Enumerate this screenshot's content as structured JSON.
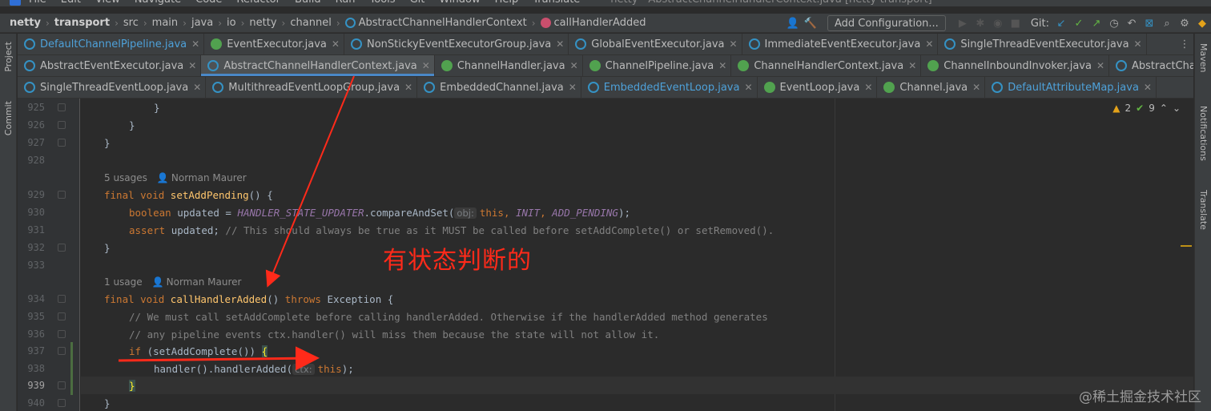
{
  "menubar": {
    "items": [
      "File",
      "Edit",
      "View",
      "Navigate",
      "Code",
      "Refactor",
      "Build",
      "Run",
      "Tools",
      "Git",
      "Window",
      "Help",
      "Translate"
    ],
    "window_title": "netty - AbstractChannelHandlerContext.java [netty-transport]"
  },
  "breadcrumb": {
    "items": [
      "netty",
      "transport",
      "src",
      "main",
      "java",
      "io",
      "netty",
      "channel",
      "AbstractChannelHandlerContext",
      "callHandlerAdded"
    ]
  },
  "toolbar": {
    "add_configuration": "Add Configuration...",
    "git_label": "Git:"
  },
  "tabs": {
    "row1": [
      {
        "label": "DefaultChannelPipeline.java",
        "icon": "class-icon",
        "highlighted": true
      },
      {
        "label": "EventExecutor.java",
        "icon": "interface-icon"
      },
      {
        "label": "NonStickyEventExecutorGroup.java",
        "icon": "class-icon"
      },
      {
        "label": "GlobalEventExecutor.java",
        "icon": "class-icon"
      },
      {
        "label": "ImmediateEventExecutor.java",
        "icon": "class-icon"
      },
      {
        "label": "SingleThreadEventExecutor.java",
        "icon": "class-icon"
      }
    ],
    "row2": [
      {
        "label": "AbstractEventExecutor.java",
        "icon": "class-icon"
      },
      {
        "label": "AbstractChannelHandlerContext.java",
        "icon": "class-icon",
        "active": true
      },
      {
        "label": "ChannelHandler.java",
        "icon": "interface-icon"
      },
      {
        "label": "ChannelPipeline.java",
        "icon": "interface-icon"
      },
      {
        "label": "ChannelHandlerContext.java",
        "icon": "interface-icon"
      },
      {
        "label": "ChannelInboundInvoker.java",
        "icon": "interface-icon"
      },
      {
        "label": "AbstractChannel.java",
        "icon": "class-icon"
      }
    ],
    "row3": [
      {
        "label": "SingleThreadEventLoop.java",
        "icon": "class-icon"
      },
      {
        "label": "MultithreadEventLoopGroup.java",
        "icon": "class-icon"
      },
      {
        "label": "EmbeddedChannel.java",
        "icon": "class-icon"
      },
      {
        "label": "EmbeddedEventLoop.java",
        "icon": "class-icon",
        "highlighted": true
      },
      {
        "label": "EventLoop.java",
        "icon": "interface-icon"
      },
      {
        "label": "Channel.java",
        "icon": "interface-icon"
      },
      {
        "label": "DefaultAttributeMap.java",
        "icon": "class-icon",
        "highlighted": true
      }
    ]
  },
  "side_tools": {
    "left": [
      "Project",
      "Commit"
    ],
    "right": [
      "Maven",
      "Notifications",
      "Translate"
    ]
  },
  "inspections": {
    "warnings": "2",
    "checks": "9"
  },
  "editor": {
    "line_numbers": [
      "925",
      "926",
      "927",
      "928",
      "929",
      "930",
      "931",
      "932",
      "933",
      "934",
      "935",
      "936",
      "937",
      "938",
      "939",
      "940"
    ],
    "meta1": {
      "usages": "5 usages",
      "author": "Norman Maurer"
    },
    "meta2": {
      "usages": "1 usage",
      "author": "Norman Maurer"
    },
    "hint_obj": "obj:",
    "hint_ctx": "ctx:",
    "code": {
      "l925": "}",
      "l926": "}",
      "l927": "}",
      "l929_kw": "final void ",
      "l929_fn": "setAddPending",
      "l929_rest": "() {",
      "l930_kw": "boolean ",
      "l930_a": "updated = ",
      "l930_st": "HANDLER_STATE_UPDATER",
      "l930_b": ".compareAndSet(",
      "l930_this": "this",
      "l930_c": ", ",
      "l930_st2": "INIT",
      "l930_d": ", ",
      "l930_st3": "ADD_PENDING",
      "l930_e": ");",
      "l931_kw": "assert ",
      "l931_a": "updated; ",
      "l931_cm": "// This should always be true as it MUST be called before setAddComplete() or setRemoved().",
      "l932": "}",
      "l934_kw": "final void ",
      "l934_fn": "callHandlerAdded",
      "l934_a": "() ",
      "l934_kw2": "throws ",
      "l934_b": "Exception {",
      "l935_cm": "// We must call setAddComplete before calling handlerAdded. Otherwise if the handlerAdded method generates",
      "l936_cm": "// any pipeline events ctx.handler() will miss them because the state will not allow it.",
      "l937_kw": "if ",
      "l937_a": "(setAddComplete()) ",
      "l937_brace": "{",
      "l938_a": "handler().handlerAdded(",
      "l938_this": "this",
      "l938_b": ");",
      "l939_brace": "}",
      "l940": "}"
    }
  },
  "annotation": {
    "text": "有状态判断的"
  },
  "watermark": "@稀土掘金技术社区",
  "colors": {
    "arrow": "#ff2a1a",
    "accent": "#4a88c7"
  }
}
